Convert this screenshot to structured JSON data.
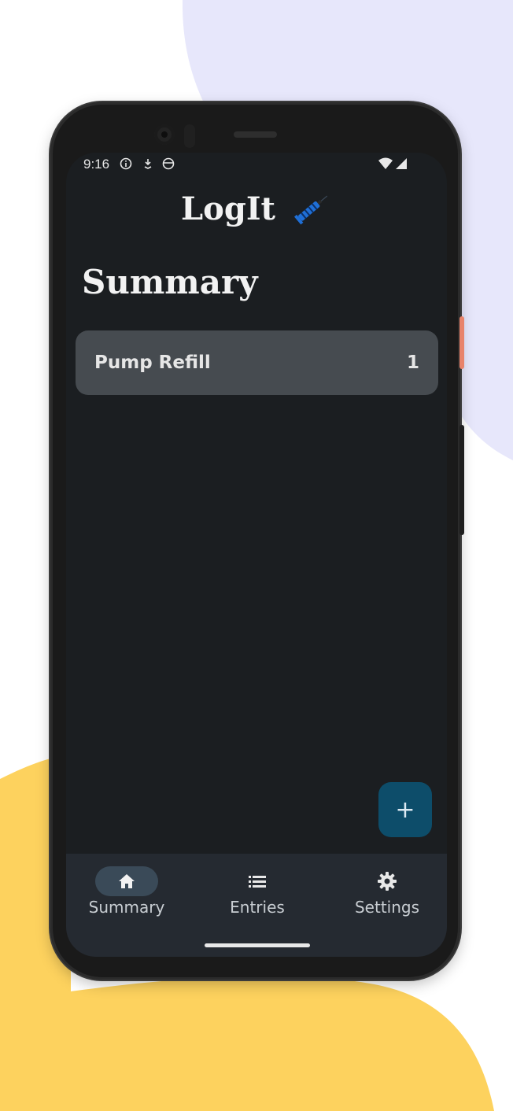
{
  "status_bar": {
    "time": "9:16",
    "icons": [
      "info-icon",
      "download-icon",
      "face-icon"
    ],
    "right_icons": [
      "wifi-icon",
      "signal-icon"
    ]
  },
  "app": {
    "title": "LogIt",
    "logo_icon": "syringe-icon",
    "accent_color": "#0d4d6a"
  },
  "page": {
    "title": "Summary"
  },
  "summary_items": [
    {
      "label": "Pump Refill",
      "count": "1"
    }
  ],
  "fab": {
    "icon": "plus-icon",
    "label": "+"
  },
  "nav": {
    "items": [
      {
        "label": "Summary",
        "icon": "home-icon",
        "active": true
      },
      {
        "label": "Entries",
        "icon": "list-icon",
        "active": false
      },
      {
        "label": "Settings",
        "icon": "gear-icon",
        "active": false
      }
    ]
  },
  "colors": {
    "background_blob_top": "#e7e7fb",
    "background_blob_bottom": "#fdd25e",
    "screen_bg": "#1b1e21",
    "card_bg": "#464b50",
    "nav_bg": "#252a31"
  }
}
